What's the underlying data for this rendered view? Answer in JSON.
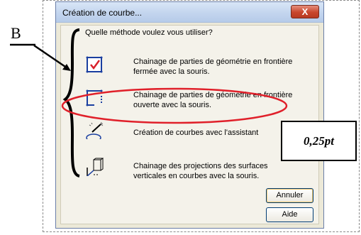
{
  "window": {
    "title": "Création de courbe...",
    "close_glyph": "X"
  },
  "question": "Quelle méthode voulez vous utiliser?",
  "options": [
    {
      "icon": "closed-boundary-icon",
      "line1": "Chainage de parties de géométrie en frontière",
      "line2": "fermée avec la souris."
    },
    {
      "icon": "open-boundary-icon",
      "line1": "Chainage de parties de géométrie en frontière",
      "line2": "ouverte avec la souris."
    },
    {
      "icon": "wizard-icon",
      "line1": "Création de courbes avec l'assistant",
      "line2": ""
    },
    {
      "icon": "vertical-projection-icon",
      "line1": "Chainage des projections des surfaces",
      "line2": "verticales en courbes avec la souris."
    }
  ],
  "buttons": {
    "cancel": "Annuler",
    "help": "Aide"
  },
  "annotations": {
    "label_b": "B",
    "note": "0,25pt",
    "highlight_color": "#e0202a"
  }
}
